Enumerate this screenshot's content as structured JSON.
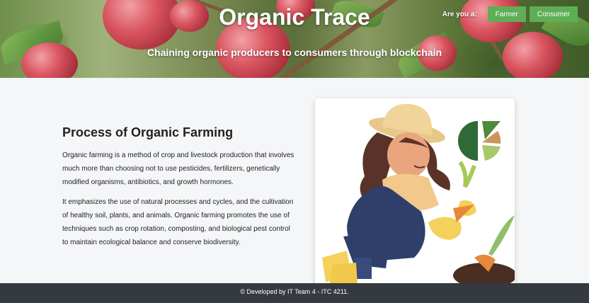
{
  "header": {
    "title": "Organic Trace",
    "subtitle": "Chaining organic producers to consumers through blockchain",
    "role_prompt": "Are you a:",
    "role_buttons": [
      {
        "label": "Farmer"
      },
      {
        "label": "Consumer"
      }
    ]
  },
  "main": {
    "heading": "Process of Organic Farming",
    "paragraphs": [
      "Organic farming is a method of crop and livestock production that involves much more than choosing not to use pesticides, fertilizers, genetically modified organisms, antibiotics, and growth hormones.",
      "It emphasizes the use of natural processes and cycles, and the cultivation of healthy soil, plants, and animals. Organic farming promotes the use of techniques such as crop rotation, composting, and biological pest control to maintain ecological balance and conserve biodiversity."
    ]
  },
  "footer": {
    "text": "© Developed by IT Team 4 - ITC 4211."
  },
  "colors": {
    "button": "#5fae55",
    "footer": "#343a40",
    "page_bg": "#f5f6f8"
  }
}
